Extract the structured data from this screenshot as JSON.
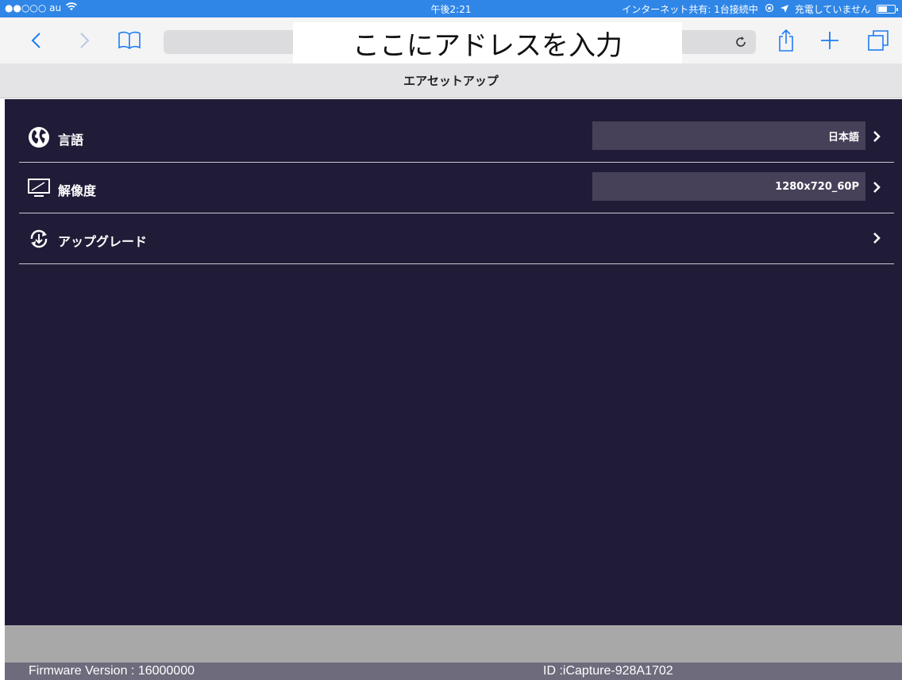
{
  "status_bar": {
    "carrier": "●●○○○ au",
    "time": "午後2:21",
    "tethering": "インターネット共有: 1台接続中",
    "charging": "充電していません"
  },
  "browser": {
    "address_text": "ここにアドレスを入力",
    "icons": [
      "back-icon",
      "forward-icon",
      "bookmarks-icon",
      "reload-icon",
      "share-icon",
      "new-tab-icon",
      "tabs-icon"
    ]
  },
  "page": {
    "title": "エアセットアップ"
  },
  "settings": [
    {
      "label": "言語",
      "value": "日本語",
      "icon": "globe-icon"
    },
    {
      "label": "解像度",
      "value": "1280x720_60P",
      "icon": "monitor-icon"
    },
    {
      "label": "アップグレード",
      "value": "",
      "icon": "upgrade-icon"
    }
  ],
  "footer": {
    "firmware": "Firmware Version : 16000000",
    "device_id": "ID :iCapture-928A1702"
  },
  "colors": {
    "status_bar": "#2f86e6",
    "accent": "#1e7cf2",
    "content_bg": "#201b36",
    "value_box": "#464158",
    "footer_bar": "#6e6b7c"
  }
}
